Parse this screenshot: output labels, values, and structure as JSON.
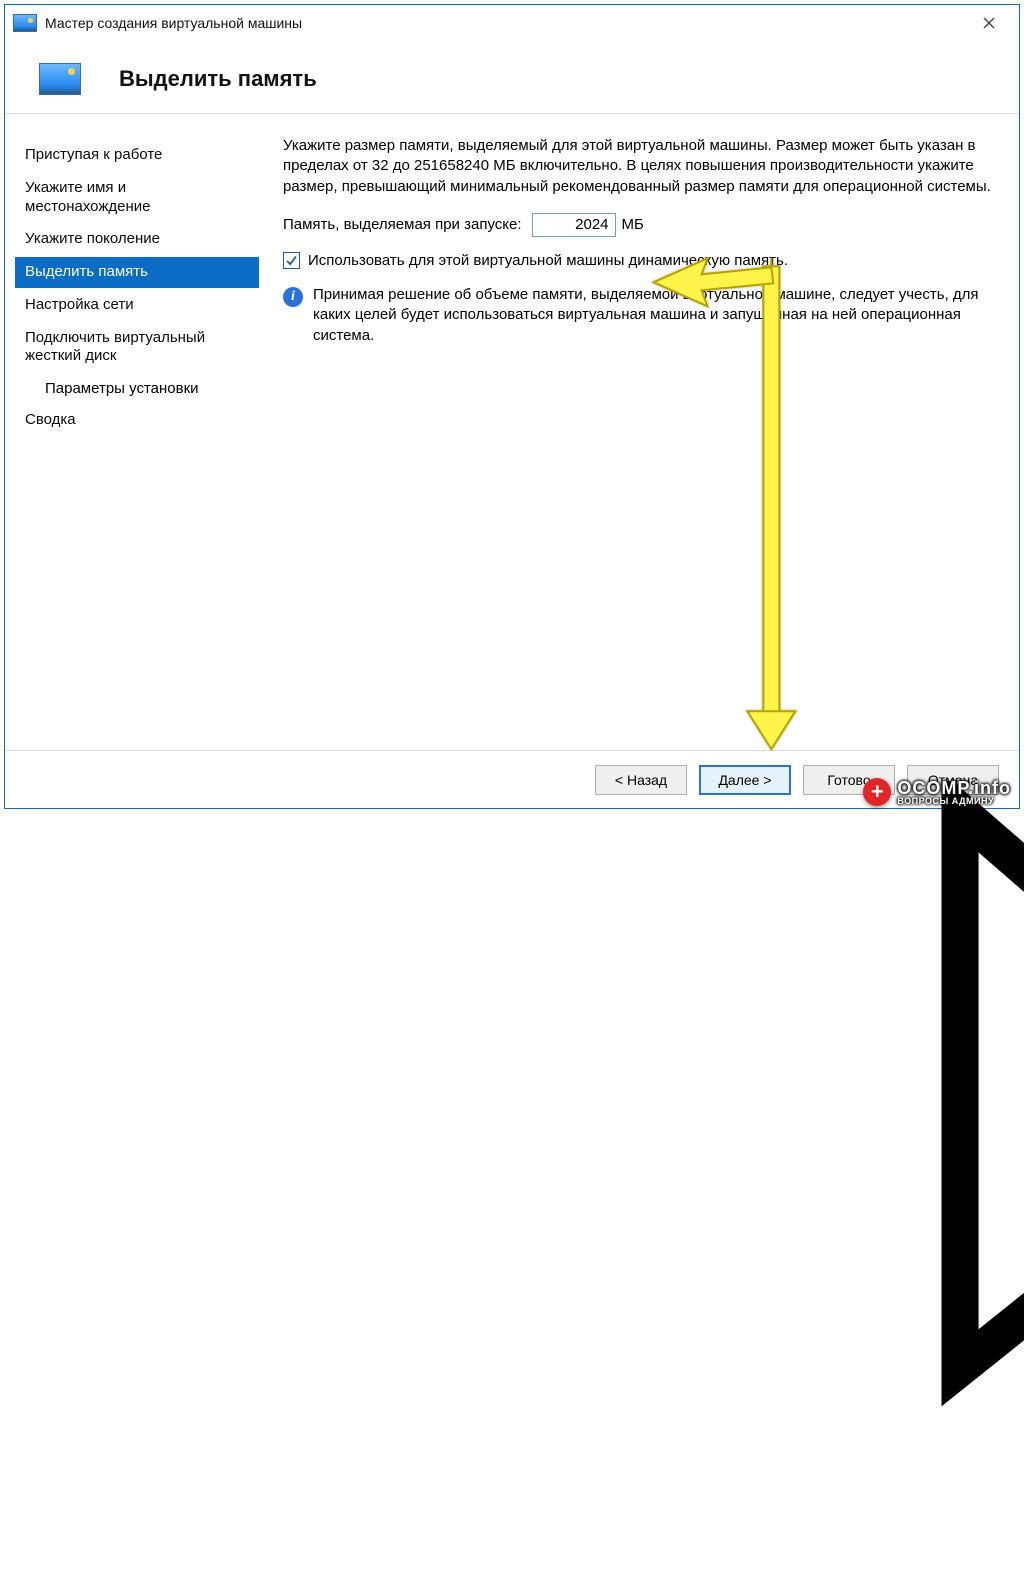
{
  "window": {
    "title": "Мастер создания виртуальной машины"
  },
  "header": {
    "title": "Выделить память"
  },
  "sidebar": {
    "items": [
      {
        "label": "Приступая к работе",
        "selected": false
      },
      {
        "label": "Укажите имя и местонахождение",
        "selected": false
      },
      {
        "label": "Укажите поколение",
        "selected": false
      },
      {
        "label": "Выделить память",
        "selected": true
      },
      {
        "label": "Настройка сети",
        "selected": false
      },
      {
        "label": "Подключить виртуальный жесткий диск",
        "selected": false
      }
    ],
    "subitems": [
      {
        "label": "Параметры установки"
      }
    ],
    "final": {
      "label": "Сводка"
    }
  },
  "content": {
    "intro": "Укажите размер памяти, выделяемый для этой виртуальной машины. Размер может быть указан в пределах от 32 до 251658240 МБ включительно. В целях повышения производительности укажите размер, превышающий минимальный рекомендованный размер памяти для операционной системы.",
    "memory_label": "Память, выделяемая при запуске:",
    "memory_value": "2024",
    "memory_unit": "МБ",
    "checkbox_label": "Использовать для этой виртуальной машины динамическую память.",
    "checkbox_checked": true,
    "info_text": "Принимая решение об объеме памяти, выделяемой виртуальной машине, следует учесть, для каких целей будет использоваться виртуальная машина и запущенная на ней операционная система."
  },
  "buttons": {
    "back": "< Назад",
    "next": "Далее >",
    "finish": "Готово",
    "cancel": "Отмена"
  },
  "watermark": {
    "main": "OCOMP.info",
    "sub": "ВОПРОСЫ АДМИНУ"
  }
}
